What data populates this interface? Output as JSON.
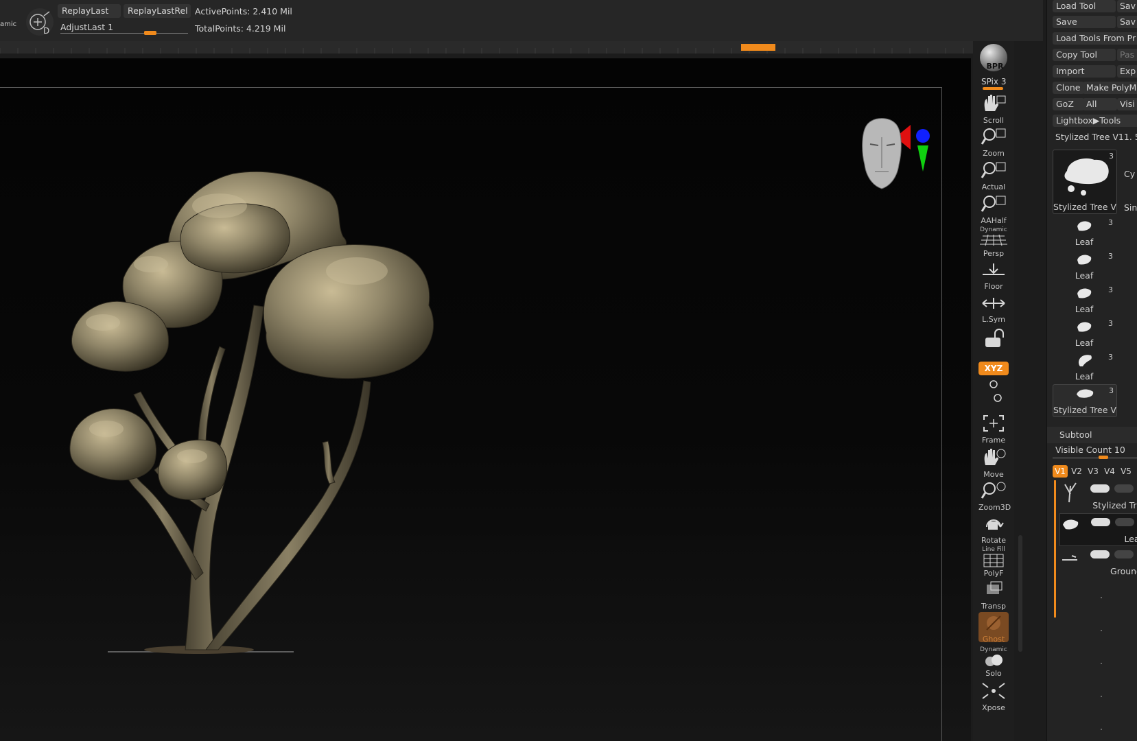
{
  "topbar": {
    "dynamic_label": "amic",
    "replay_last": "ReplayLast",
    "replay_last_rel": "ReplayLastRel",
    "active_points": "ActivePoints: 2.410 Mil",
    "adjust_last": "AdjustLast 1",
    "total_points": "TotalPoints: 4.219 Mil",
    "adjust_last_value": 1
  },
  "shelf": {
    "bpr": "BPR",
    "spix": "SPix 3",
    "scroll": "Scroll",
    "zoom": "Zoom",
    "actual": "Actual",
    "aahalf": "AAHalf",
    "persp_top": "Dynamic",
    "persp": "Persp",
    "floor": "Floor",
    "lsym": "L.Sym",
    "xyz": "XYZ",
    "frame": "Frame",
    "move": "Move",
    "zoom3d": "Zoom3D",
    "rotate": "Rotate",
    "polyf_top": "Line Fill",
    "polyf": "PolyF",
    "transp": "Transp",
    "ghost": "Ghost",
    "solo_top": "Dynamic",
    "solo": "Solo",
    "xpose": "Xpose"
  },
  "tool_panel": {
    "load_tool": "Load Tool",
    "save_as_partial": "Sav",
    "save": "Save",
    "save_r": "Sav",
    "load_tools_from_project": "Load Tools From Pr",
    "copy_tool": "Copy Tool",
    "paste_partial": "Pas",
    "import": "Import",
    "export_partial": "Exp",
    "clone": "Clone",
    "make_polymesh": "Make PolyM",
    "goz": "GoZ",
    "all": "All",
    "visible_partial": "Visi",
    "lightbox_tools": "Lightbox▶Tools",
    "current_tool": "Stylized Tree V11. 5",
    "thumbs": [
      {
        "label": "Stylized Tree V",
        "count": "3"
      },
      {
        "label": "Leaf",
        "count": "3"
      },
      {
        "label": "Leaf",
        "count": "3"
      },
      {
        "label": "Leaf",
        "count": "3"
      },
      {
        "label": "Leaf",
        "count": "3"
      },
      {
        "label": "Leaf",
        "count": "3"
      },
      {
        "label": "Stylized Tree V",
        "count": "3"
      }
    ],
    "side_partial_1": "Cy",
    "side_partial_2": "Sin"
  },
  "subtool": {
    "title": "Subtool",
    "visible_count": "Visible Count 10",
    "visible_count_value": 10,
    "tabs": [
      "V1",
      "V2",
      "V3",
      "V4",
      "V5"
    ],
    "active_tab": "V1",
    "items": [
      {
        "name": "Stylized Tre"
      },
      {
        "name": "Leaf"
      },
      {
        "name": "Ground"
      }
    ]
  },
  "colors": {
    "accent": "#f08a1c",
    "background": "#1c1c1c",
    "viewport": "#050505",
    "tree_canopy": "#8f8568",
    "gizmo_red": "#e01010",
    "gizmo_green": "#10d010",
    "gizmo_blue": "#1020ff"
  }
}
